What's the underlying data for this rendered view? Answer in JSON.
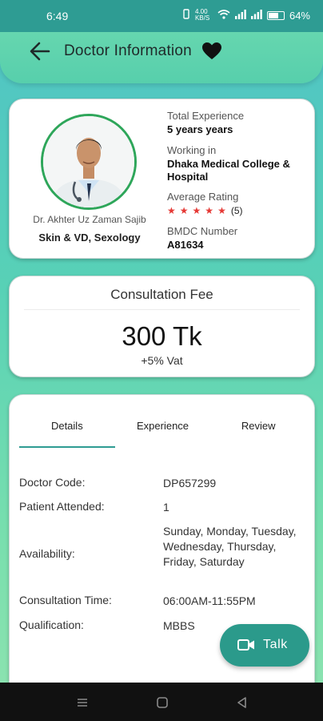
{
  "status_bar": {
    "time": "6:49",
    "speed": "4.00 KB/S",
    "battery": "64%"
  },
  "header": {
    "title": "Doctor Information"
  },
  "profile": {
    "name": "Dr. Akhter Uz Zaman Sajib",
    "specialty": "Skin & VD, Sexology",
    "experience_label": "Total Experience",
    "experience_value": "5 years years",
    "working_label": "Working in",
    "working_value": "Dhaka Medical College & Hospital",
    "rating_label": "Average Rating",
    "rating_stars": 5,
    "rating_count": "(5)",
    "bmdc_label": "BMDC Number",
    "bmdc_value": "A81634"
  },
  "fee": {
    "title": "Consultation Fee",
    "amount": "300 Tk",
    "vat": "+5% Vat"
  },
  "tabs": [
    {
      "label": "Details",
      "active": true
    },
    {
      "label": "Experience",
      "active": false
    },
    {
      "label": "Review",
      "active": false
    }
  ],
  "details": [
    {
      "label": "Doctor Code:",
      "value": "DP657299"
    },
    {
      "label": "Patient Attended:",
      "value": "1"
    },
    {
      "label": "Availability:",
      "value": "Sunday, Monday, Tuesday, Wednesday, Thursday, Friday, Saturday"
    },
    {
      "label": "Consultation Time:",
      "value": "06:00AM-11:55PM"
    },
    {
      "label": "Qualification:",
      "value": "MBBS"
    }
  ],
  "talk_button": {
    "label": "Talk"
  },
  "colors": {
    "accent": "#2b9a8b",
    "star": "#e53935",
    "avatar_ring": "#2ea65a"
  }
}
